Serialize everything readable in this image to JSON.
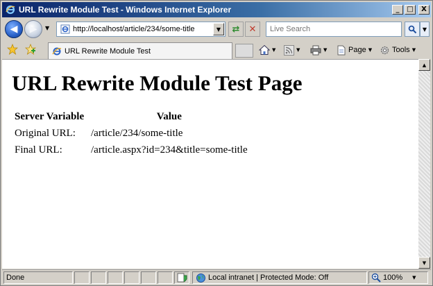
{
  "window": {
    "title": "URL Rewrite Module Test - Windows Internet Explorer",
    "minimize": "_",
    "maximize": "□",
    "close": "X"
  },
  "nav": {
    "address": "http://localhost/article/234/some-title",
    "search_placeholder": "Live Search"
  },
  "tab": {
    "label": "URL Rewrite Module Test"
  },
  "commands": {
    "page": "Page",
    "tools": "Tools"
  },
  "page": {
    "heading": "URL Rewrite Module Test Page",
    "table": {
      "headers": [
        "Server Variable",
        "Value"
      ],
      "rows": [
        {
          "label": "Original URL:",
          "value": "/article/234/some-title"
        },
        {
          "label": "Final URL:",
          "value": "/article.aspx?id=234&title=some-title"
        }
      ]
    }
  },
  "status": {
    "text": "Done",
    "zone": "Local intranet | Protected Mode: Off",
    "zoom": "100%"
  }
}
